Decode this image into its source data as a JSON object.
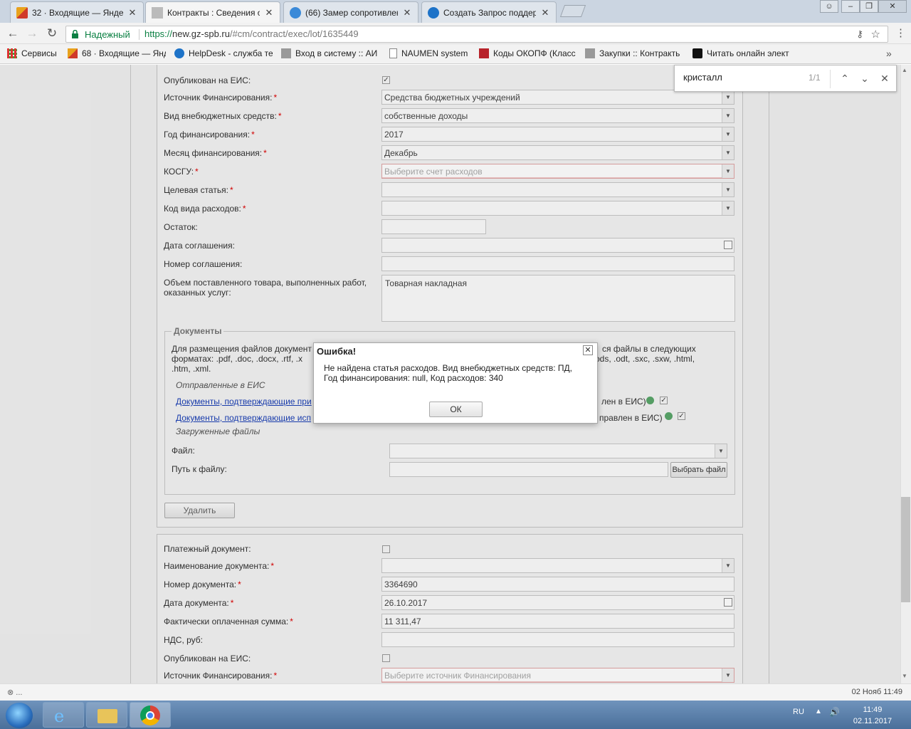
{
  "browser": {
    "tabs": [
      {
        "title": "32 · Входящие — Яндекс",
        "icon": "mail-icon",
        "color": "#e8a21c"
      },
      {
        "title": "Контракты : Сведения о",
        "icon": "tools-icon",
        "color": "#555555",
        "active": true
      },
      {
        "title": "(66) Замер сопротивлен",
        "icon": "globe-icon",
        "color": "#3b8ad8"
      },
      {
        "title": "Создать Запрос поддерж",
        "icon": "help-icon",
        "color": "#1e73c8"
      }
    ],
    "secure_label": "Надежный",
    "url_scheme": "https://",
    "url_host": "new.gz-spb.ru",
    "url_path": "/#cm/contract/exec/lot/1635449",
    "bookmarks": [
      {
        "label": "Сервисы",
        "icon": "apps-icon"
      },
      {
        "label": "68 · Входящие — Янд",
        "icon": "mail-icon"
      },
      {
        "label": "HelpDesk - служба те",
        "icon": "help-icon"
      },
      {
        "label": "Вход в систему :: АИ",
        "icon": "tools-icon"
      },
      {
        "label": "NAUMEN system",
        "icon": "page-icon"
      },
      {
        "label": "Коды ОКОПФ (Класс",
        "icon": "red-square-icon"
      },
      {
        "label": "Закупки :: Контракть",
        "icon": "tools-icon"
      },
      {
        "label": "Читать онлайн элект",
        "icon": "book-icon"
      }
    ],
    "bookmarks_more": "»"
  },
  "find": {
    "query": "кристалл",
    "count": "1/1"
  },
  "form": {
    "published_label": "Опубликован на ЕИС:",
    "funding_source_label": "Источник Финансирования:",
    "funding_source_value": "Средства бюджетных учреждений",
    "extrabudget_label": "Вид внебюджетных средств:",
    "extrabudget_value": "собственные доходы",
    "year_label": "Год финансирования:",
    "year_value": "2017",
    "month_label": "Месяц финансирования:",
    "month_value": "Декабрь",
    "kosgu_label": "КОСГУ:",
    "kosgu_placeholder": "Выберите счет расходов",
    "target_label": "Целевая статья:",
    "expense_code_label": "Код вида расходов:",
    "balance_label": "Остаток:",
    "agreement_date_label": "Дата соглашения:",
    "agreement_number_label": "Номер соглашения:",
    "volume_label_1": "Объем поставленного товара, выполненных работ,",
    "volume_label_2": "оказанных услуг:",
    "volume_value": "Товарная накладная"
  },
  "documents": {
    "legend": "Документы",
    "text_left": "Для размещения файлов документ",
    "text_right": "ся файлы в следующих",
    "text_line2_left": "форматах: .pdf, .doc, .docx, .rtf, .x",
    "text_line2_right": "ods, .odt, .sxc, .sxw, .html,",
    "text_line3": ".htm, .xml.",
    "sent_label": "Отправленные в ЕИС",
    "link1": "Документы, подтверждающие при",
    "link1_tail": "лен в ЕИС)",
    "link2": "Документы, подтверждающие исп",
    "link2_tail": "правлен в ЕИС)",
    "uploaded_label": "Загруженные файлы",
    "file_label": "Файл:",
    "path_label": "Путь к файлу:",
    "browse_button": "Выбрать файл",
    "delete_button": "Удалить"
  },
  "payment": {
    "payment_doc_label": "Платежный документ:",
    "doc_name_label": "Наименование документа:",
    "doc_number_label": "Номер документа:",
    "doc_number_value": "3364690",
    "doc_date_label": "Дата документа:",
    "doc_date_value": "26.10.2017",
    "paid_sum_label": "Фактически оплаченная сумма:",
    "paid_sum_value": "11 311,47",
    "vat_label": "НДС, руб:",
    "published_label": "Опубликован на ЕИС:",
    "funding_source_label": "Источник Финансирования:",
    "funding_source_placeholder": "Выберите источник Финансирования"
  },
  "dialog": {
    "title": "Ошибка!",
    "message_line1": "Не найдена статья расходов. Вид внебюджетных средств: ПД,",
    "message_line2": "Год финансирования: null, Код расходов: 340",
    "ok_button": "ОК"
  },
  "status": {
    "left": "⊗ ...",
    "right": "02 Нояб 11:49"
  },
  "taskbar": {
    "lang": "RU",
    "time": "11:49",
    "date": "02.11.2017"
  },
  "colors": {
    "required": "#dd0000",
    "link": "#1a3fb5",
    "secure": "#0b8043"
  }
}
